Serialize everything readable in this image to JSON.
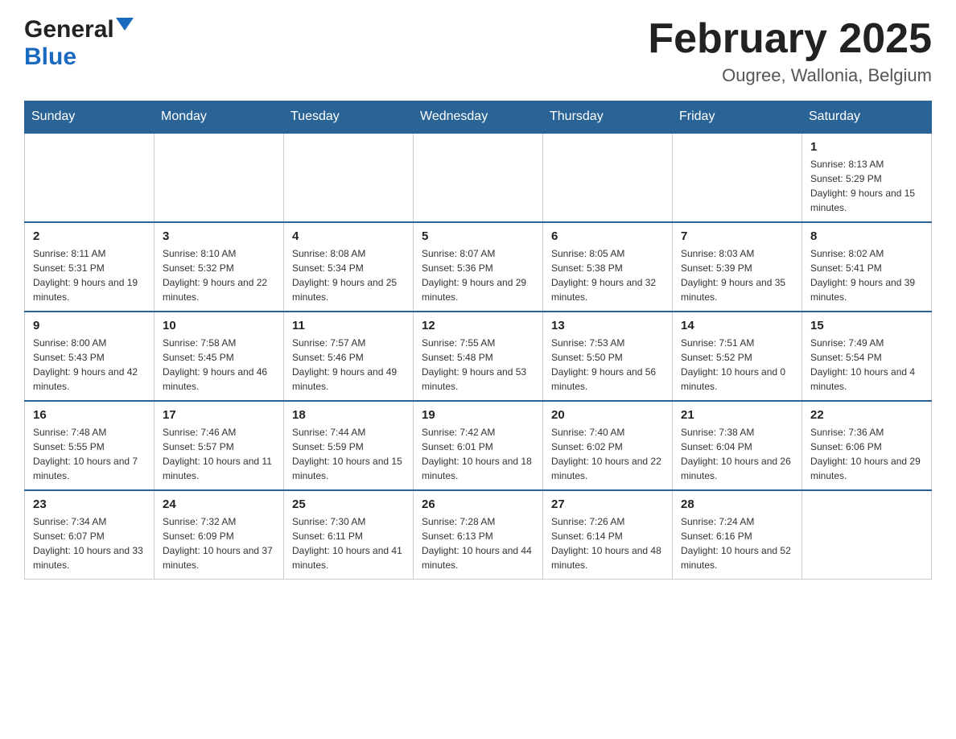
{
  "header": {
    "logo_general": "General",
    "logo_blue": "Blue",
    "month_title": "February 2025",
    "location": "Ougree, Wallonia, Belgium"
  },
  "days_of_week": [
    "Sunday",
    "Monday",
    "Tuesday",
    "Wednesday",
    "Thursday",
    "Friday",
    "Saturday"
  ],
  "weeks": [
    {
      "days": [
        {
          "date": "",
          "info": ""
        },
        {
          "date": "",
          "info": ""
        },
        {
          "date": "",
          "info": ""
        },
        {
          "date": "",
          "info": ""
        },
        {
          "date": "",
          "info": ""
        },
        {
          "date": "",
          "info": ""
        },
        {
          "date": "1",
          "info": "Sunrise: 8:13 AM\nSunset: 5:29 PM\nDaylight: 9 hours and 15 minutes."
        }
      ]
    },
    {
      "days": [
        {
          "date": "2",
          "info": "Sunrise: 8:11 AM\nSunset: 5:31 PM\nDaylight: 9 hours and 19 minutes."
        },
        {
          "date": "3",
          "info": "Sunrise: 8:10 AM\nSunset: 5:32 PM\nDaylight: 9 hours and 22 minutes."
        },
        {
          "date": "4",
          "info": "Sunrise: 8:08 AM\nSunset: 5:34 PM\nDaylight: 9 hours and 25 minutes."
        },
        {
          "date": "5",
          "info": "Sunrise: 8:07 AM\nSunset: 5:36 PM\nDaylight: 9 hours and 29 minutes."
        },
        {
          "date": "6",
          "info": "Sunrise: 8:05 AM\nSunset: 5:38 PM\nDaylight: 9 hours and 32 minutes."
        },
        {
          "date": "7",
          "info": "Sunrise: 8:03 AM\nSunset: 5:39 PM\nDaylight: 9 hours and 35 minutes."
        },
        {
          "date": "8",
          "info": "Sunrise: 8:02 AM\nSunset: 5:41 PM\nDaylight: 9 hours and 39 minutes."
        }
      ]
    },
    {
      "days": [
        {
          "date": "9",
          "info": "Sunrise: 8:00 AM\nSunset: 5:43 PM\nDaylight: 9 hours and 42 minutes."
        },
        {
          "date": "10",
          "info": "Sunrise: 7:58 AM\nSunset: 5:45 PM\nDaylight: 9 hours and 46 minutes."
        },
        {
          "date": "11",
          "info": "Sunrise: 7:57 AM\nSunset: 5:46 PM\nDaylight: 9 hours and 49 minutes."
        },
        {
          "date": "12",
          "info": "Sunrise: 7:55 AM\nSunset: 5:48 PM\nDaylight: 9 hours and 53 minutes."
        },
        {
          "date": "13",
          "info": "Sunrise: 7:53 AM\nSunset: 5:50 PM\nDaylight: 9 hours and 56 minutes."
        },
        {
          "date": "14",
          "info": "Sunrise: 7:51 AM\nSunset: 5:52 PM\nDaylight: 10 hours and 0 minutes."
        },
        {
          "date": "15",
          "info": "Sunrise: 7:49 AM\nSunset: 5:54 PM\nDaylight: 10 hours and 4 minutes."
        }
      ]
    },
    {
      "days": [
        {
          "date": "16",
          "info": "Sunrise: 7:48 AM\nSunset: 5:55 PM\nDaylight: 10 hours and 7 minutes."
        },
        {
          "date": "17",
          "info": "Sunrise: 7:46 AM\nSunset: 5:57 PM\nDaylight: 10 hours and 11 minutes."
        },
        {
          "date": "18",
          "info": "Sunrise: 7:44 AM\nSunset: 5:59 PM\nDaylight: 10 hours and 15 minutes."
        },
        {
          "date": "19",
          "info": "Sunrise: 7:42 AM\nSunset: 6:01 PM\nDaylight: 10 hours and 18 minutes."
        },
        {
          "date": "20",
          "info": "Sunrise: 7:40 AM\nSunset: 6:02 PM\nDaylight: 10 hours and 22 minutes."
        },
        {
          "date": "21",
          "info": "Sunrise: 7:38 AM\nSunset: 6:04 PM\nDaylight: 10 hours and 26 minutes."
        },
        {
          "date": "22",
          "info": "Sunrise: 7:36 AM\nSunset: 6:06 PM\nDaylight: 10 hours and 29 minutes."
        }
      ]
    },
    {
      "days": [
        {
          "date": "23",
          "info": "Sunrise: 7:34 AM\nSunset: 6:07 PM\nDaylight: 10 hours and 33 minutes."
        },
        {
          "date": "24",
          "info": "Sunrise: 7:32 AM\nSunset: 6:09 PM\nDaylight: 10 hours and 37 minutes."
        },
        {
          "date": "25",
          "info": "Sunrise: 7:30 AM\nSunset: 6:11 PM\nDaylight: 10 hours and 41 minutes."
        },
        {
          "date": "26",
          "info": "Sunrise: 7:28 AM\nSunset: 6:13 PM\nDaylight: 10 hours and 44 minutes."
        },
        {
          "date": "27",
          "info": "Sunrise: 7:26 AM\nSunset: 6:14 PM\nDaylight: 10 hours and 48 minutes."
        },
        {
          "date": "28",
          "info": "Sunrise: 7:24 AM\nSunset: 6:16 PM\nDaylight: 10 hours and 52 minutes."
        },
        {
          "date": "",
          "info": ""
        }
      ]
    }
  ]
}
